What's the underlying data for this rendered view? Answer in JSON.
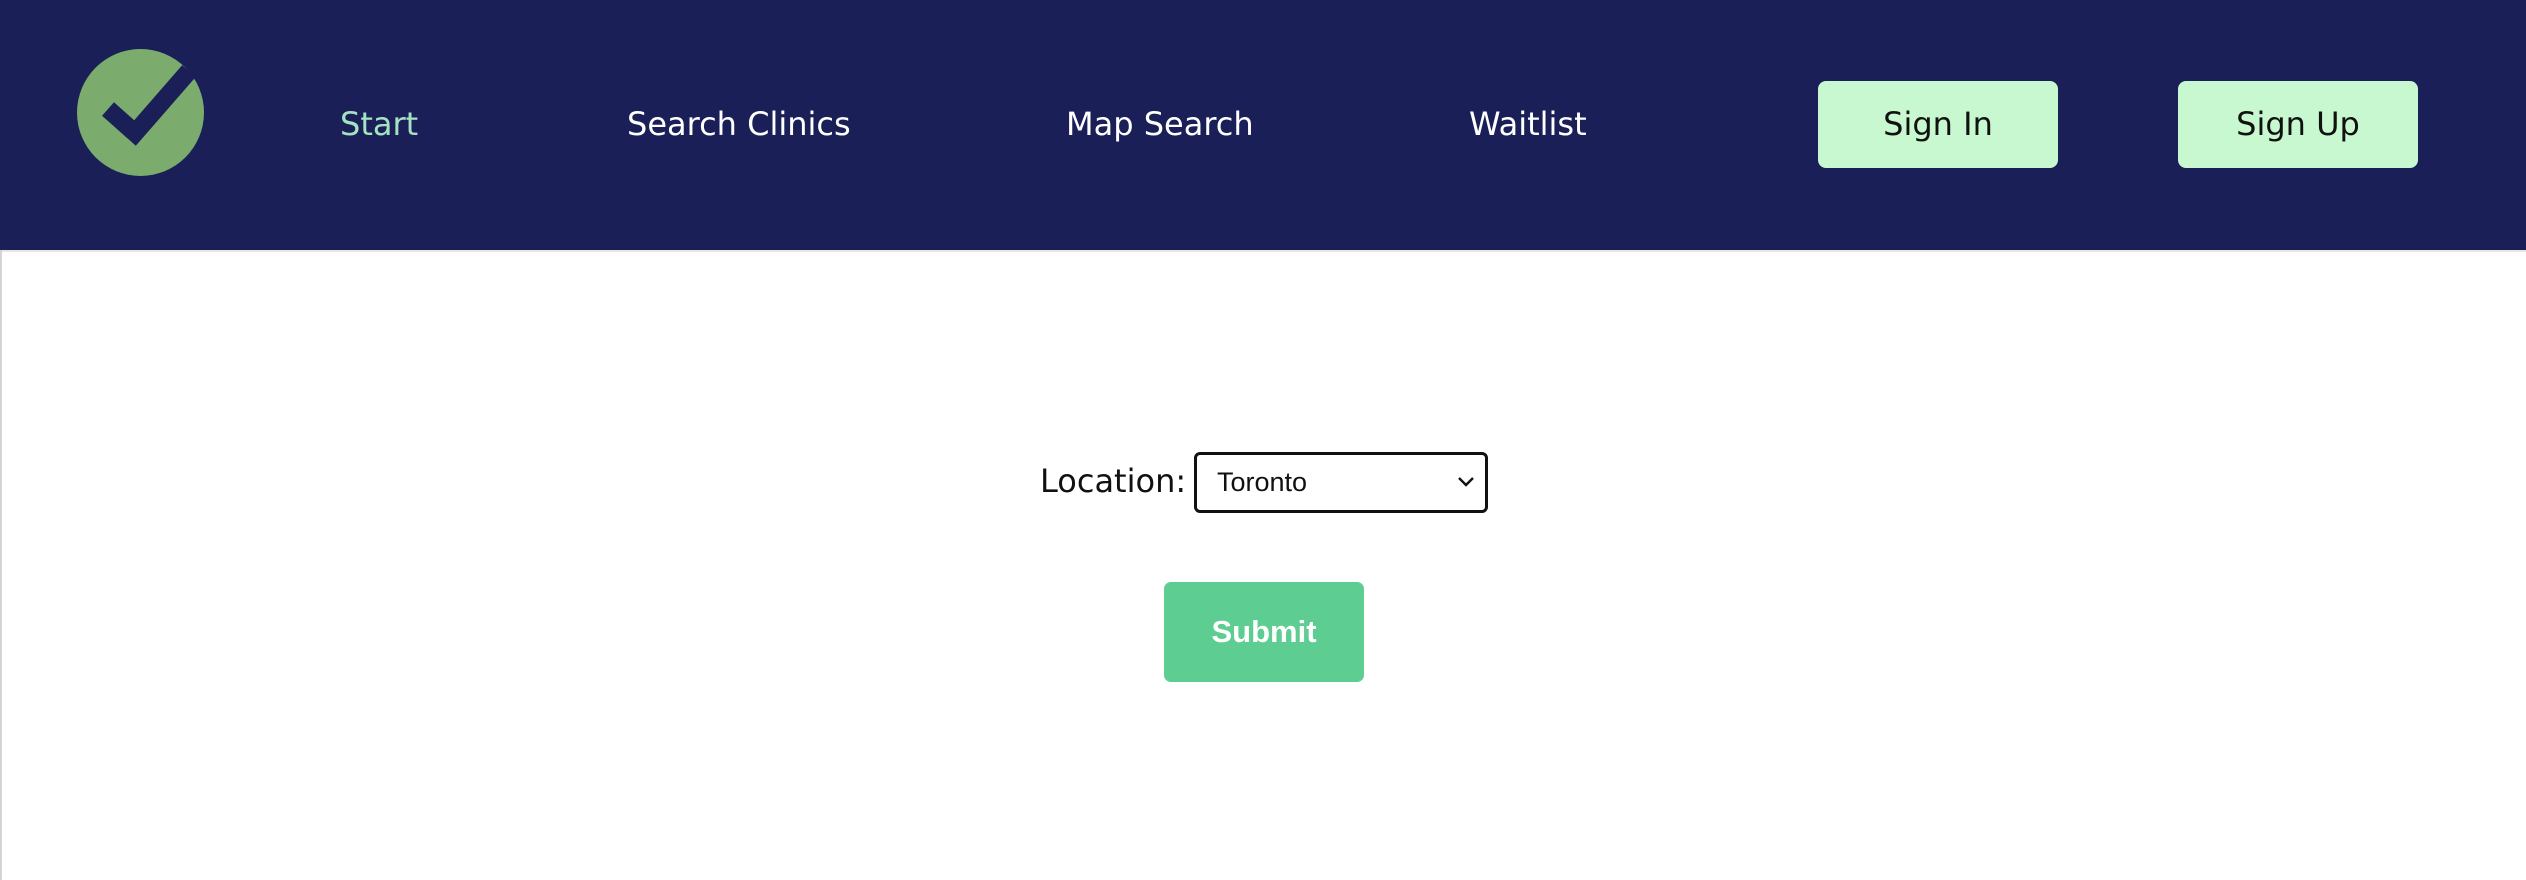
{
  "colors": {
    "nav_background": "#1a1f57",
    "nav_active": "#a4e3c2",
    "nav_text": "#ffffff",
    "auth_button": "#c8f8cf",
    "logo_circle": "#7bac6e",
    "submit_button": "#5ecd92"
  },
  "logo": {
    "icon": "checkmark-circle-icon"
  },
  "nav": {
    "links": [
      {
        "label": "Start",
        "active": true
      },
      {
        "label": "Search Clinics",
        "active": false
      },
      {
        "label": "Map Search",
        "active": false
      },
      {
        "label": "Waitlist",
        "active": false
      }
    ],
    "sign_in": "Sign In",
    "sign_up": "Sign Up"
  },
  "form": {
    "location_label": "Location:",
    "location_value": "Toronto",
    "select_icon": "chevron-down-icon",
    "submit_label": "Submit"
  }
}
